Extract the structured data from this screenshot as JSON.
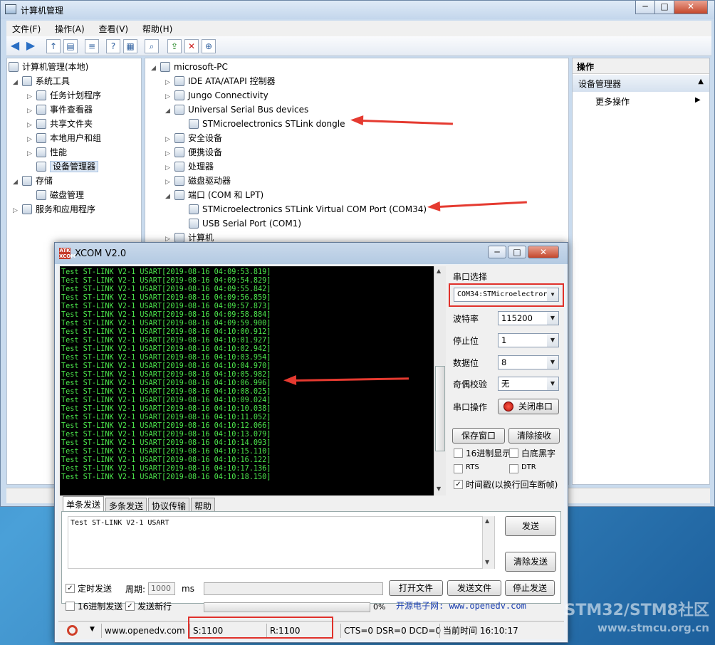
{
  "cm": {
    "title": "计算机管理",
    "menu": [
      "文件(F)",
      "操作(A)",
      "查看(V)",
      "帮助(H)"
    ],
    "left_tree": [
      {
        "label": "计算机管理(本地)",
        "expand": "",
        "depth": 0
      },
      {
        "label": "系统工具",
        "expand": "◢",
        "depth": 1
      },
      {
        "label": "任务计划程序",
        "expand": "▷",
        "depth": 2
      },
      {
        "label": "事件查看器",
        "expand": "▷",
        "depth": 2
      },
      {
        "label": "共享文件夹",
        "expand": "▷",
        "depth": 2
      },
      {
        "label": "本地用户和组",
        "expand": "▷",
        "depth": 2
      },
      {
        "label": "性能",
        "expand": "▷",
        "depth": 2
      },
      {
        "label": "设备管理器",
        "expand": "",
        "depth": 2,
        "selected": true
      },
      {
        "label": "存储",
        "expand": "◢",
        "depth": 1
      },
      {
        "label": "磁盘管理",
        "expand": "",
        "depth": 2
      },
      {
        "label": "服务和应用程序",
        "expand": "▷",
        "depth": 1
      }
    ],
    "device_tree": [
      {
        "label": "microsoft-PC",
        "expand": "◢",
        "depth": 0
      },
      {
        "label": "IDE ATA/ATAPI 控制器",
        "expand": "▷",
        "depth": 1
      },
      {
        "label": "Jungo Connectivity",
        "expand": "▷",
        "depth": 1
      },
      {
        "label": "Universal Serial Bus devices",
        "expand": "◢",
        "depth": 1
      },
      {
        "label": "STMicroelectronics STLink dongle",
        "expand": "",
        "depth": 2
      },
      {
        "label": "安全设备",
        "expand": "▷",
        "depth": 1
      },
      {
        "label": "便携设备",
        "expand": "▷",
        "depth": 1
      },
      {
        "label": "处理器",
        "expand": "▷",
        "depth": 1
      },
      {
        "label": "磁盘驱动器",
        "expand": "▷",
        "depth": 1
      },
      {
        "label": "端口 (COM 和 LPT)",
        "expand": "◢",
        "depth": 1
      },
      {
        "label": "STMicroelectronics STLink Virtual COM Port (COM34)",
        "expand": "",
        "depth": 2
      },
      {
        "label": "USB Serial Port (COM1)",
        "expand": "",
        "depth": 2
      },
      {
        "label": "计算机",
        "expand": "▷",
        "depth": 1
      }
    ],
    "actions": {
      "title": "操作",
      "group": "设备管理器",
      "more": "更多操作"
    }
  },
  "xcom": {
    "title": "XCOM V2.0",
    "logo": "ATK XCOM",
    "rx_lines": [
      "Test ST-LINK V2-1 USART[2019-08-16 04:09:53.819]",
      "Test ST-LINK V2-1 USART[2019-08-16 04:09:54.829]",
      "Test ST-LINK V2-1 USART[2019-08-16 04:09:55.842]",
      "Test ST-LINK V2-1 USART[2019-08-16 04:09:56.859]",
      "Test ST-LINK V2-1 USART[2019-08-16 04:09:57.873]",
      "Test ST-LINK V2-1 USART[2019-08-16 04:09:58.884]",
      "Test ST-LINK V2-1 USART[2019-08-16 04:09:59.900]",
      "Test ST-LINK V2-1 USART[2019-08-16 04:10:00.912]",
      "Test ST-LINK V2-1 USART[2019-08-16 04:10:01.927]",
      "Test ST-LINK V2-1 USART[2019-08-16 04:10:02.942]",
      "Test ST-LINK V2-1 USART[2019-08-16 04:10:03.954]",
      "Test ST-LINK V2-1 USART[2019-08-16 04:10:04.970]",
      "Test ST-LINK V2-1 USART[2019-08-16 04:10:05.982]",
      "Test ST-LINK V2-1 USART[2019-08-16 04:10:06.996]",
      "Test ST-LINK V2-1 USART[2019-08-16 04:10:08.025]",
      "Test ST-LINK V2-1 USART[2019-08-16 04:10:09.024]",
      "Test ST-LINK V2-1 USART[2019-08-16 04:10:10.038]",
      "Test ST-LINK V2-1 USART[2019-08-16 04:10:11.052]",
      "Test ST-LINK V2-1 USART[2019-08-16 04:10:12.066]",
      "Test ST-LINK V2-1 USART[2019-08-16 04:10:13.079]",
      "Test ST-LINK V2-1 USART[2019-08-16 04:10:14.093]",
      "Test ST-LINK V2-1 USART[2019-08-16 04:10:15.110]",
      "Test ST-LINK V2-1 USART[2019-08-16 04:10:16.122]",
      "Test ST-LINK V2-1 USART[2019-08-16 04:10:17.136]",
      "Test ST-LINK V2-1 USART[2019-08-16 04:10:18.150]"
    ],
    "settings": {
      "port_label": "串口选择",
      "port_value": "COM34:STMicroelectror",
      "baud_label": "波特率",
      "baud_value": "115200",
      "stop_label": "停止位",
      "stop_value": "1",
      "data_label": "数据位",
      "data_value": "8",
      "parity_label": "奇偶校验",
      "parity_value": "无",
      "op_label": "串口操作",
      "op_button": "关闭串口",
      "save_window": "保存窗口",
      "clear_recv": "清除接收",
      "hex_display": "16进制显示",
      "white_bg": "白底黑字",
      "rts": "RTS",
      "dtr": "DTR",
      "timestamp": "时间戳(以换行回车断帧)"
    },
    "tabs": [
      "单条发送",
      "多条发送",
      "协议传输",
      "帮助"
    ],
    "send": {
      "text": "Test ST-LINK V2-1 USART",
      "send_button": "发送",
      "clear_send": "清除发送",
      "timed_send": "定时发送",
      "period_label": "周期:",
      "period_value": "1000",
      "period_unit": "ms",
      "open_file": "打开文件",
      "send_file": "发送文件",
      "stop_send": "停止发送",
      "hex_send": "16进制发送",
      "send_newline": "发送新行",
      "progress_text": "0%",
      "progress": 0,
      "site_label": "开源电子网: www.openedv.com"
    },
    "status": {
      "url": "www.openedv.com",
      "sent": "S:1100",
      "recv": "R:1100",
      "lines": "CTS=0 DSR=0 DCD=0",
      "time": "当前时间 16:10:17"
    }
  },
  "watermark": {
    "line1": "STM32/STM8社区",
    "line2": "www.stmcu.org.cn"
  },
  "colors": {
    "accent": "#e0312b",
    "rx_text": "#4ce64c"
  }
}
